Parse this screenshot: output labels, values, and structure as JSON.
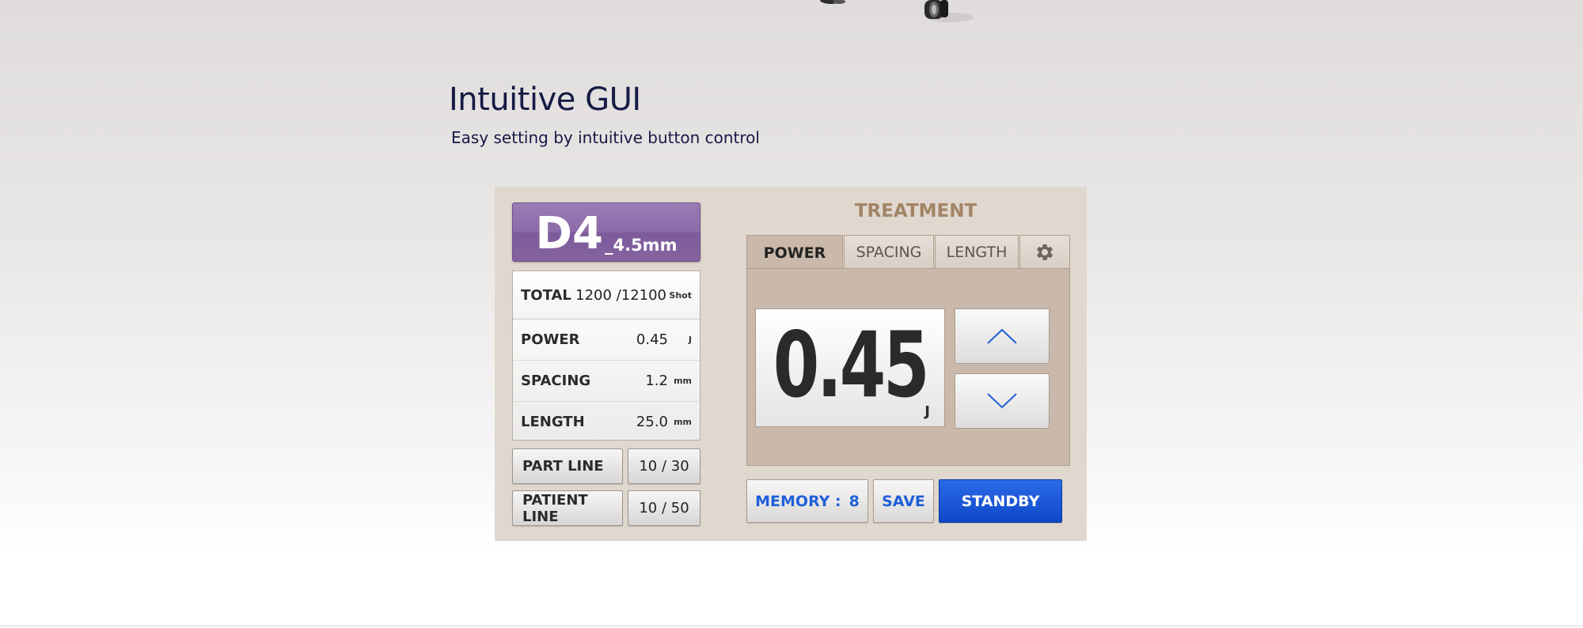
{
  "header": {
    "title": "Intuitive GUI",
    "subtitle": "Easy setting by intuitive button control"
  },
  "probe": {
    "code": "D4",
    "size": "_4.5mm",
    "color": "#8b6aa9"
  },
  "info": {
    "total": {
      "label": "TOTAL",
      "value": "1200 /12100",
      "unit": "Shot"
    },
    "rows": [
      {
        "label": "POWER",
        "value": "0.45",
        "unit": "J"
      },
      {
        "label": "SPACING",
        "value": "1.2",
        "unit": "mm"
      },
      {
        "label": "LENGTH",
        "value": "25.0",
        "unit": "mm"
      }
    ]
  },
  "lines": {
    "part_label": "PART LINE",
    "part_value": "10 / 30",
    "patient_label": "PATIENT LINE",
    "patient_value": "10 / 50"
  },
  "treatment": {
    "title": "TREATMENT",
    "tabs": [
      "POWER",
      "SPACING",
      "LENGTH"
    ],
    "active_tab": "POWER",
    "settings_icon": "gear-icon",
    "value": "0.45",
    "unit": "J",
    "up_icon": "chevron-up-icon",
    "down_icon": "chevron-down-icon"
  },
  "actions": {
    "memory_label": "MEMORY :",
    "memory_value": "8",
    "save_label": "SAVE",
    "standby_label": "STANDBY",
    "accent_color": "#1f5fd8"
  }
}
